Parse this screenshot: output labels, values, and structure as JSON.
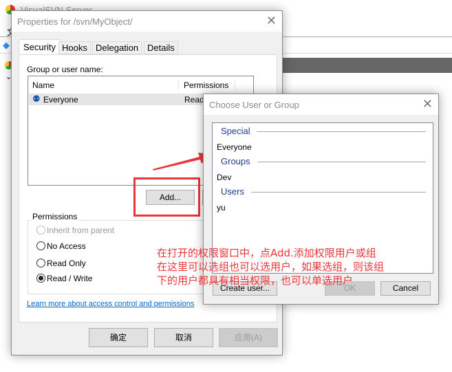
{
  "background_window": {
    "title": "VisualSVN Server",
    "menu_char": "文"
  },
  "properties": {
    "title": "Properties for /svn/MyObject/",
    "tabs": [
      "Security",
      "Hooks",
      "Delegation",
      "Details"
    ],
    "active_tab": "Security",
    "group_label": "Group or user name:",
    "columns": [
      "Name",
      "Permissions"
    ],
    "rows": [
      {
        "name": "Everyone",
        "permission": "Read"
      }
    ],
    "add_label": "Add...",
    "permissions_label": "Permissions",
    "radios": [
      {
        "label": "Inherit from parent",
        "disabled": true,
        "checked": false
      },
      {
        "label": "No Access",
        "disabled": false,
        "checked": false
      },
      {
        "label": "Read Only",
        "disabled": false,
        "checked": false
      },
      {
        "label": "Read / Write",
        "disabled": false,
        "checked": true
      }
    ],
    "link": "Learn more about access control and permissions",
    "ok_label": "确定",
    "cancel_label": "取消",
    "apply_label": "应用(A)"
  },
  "chooser": {
    "title": "Choose User or Group",
    "sections": [
      {
        "header": "Special",
        "items": [
          "Everyone"
        ]
      },
      {
        "header": "Groups",
        "items": [
          "Dev"
        ]
      },
      {
        "header": "Users",
        "items": [
          "yu"
        ]
      }
    ],
    "create_label": "Create user...",
    "ok_label": "OK",
    "cancel_label": "Cancel"
  },
  "annotation": {
    "lines": [
      "在打开的权限窗口中，点Add.添加权限用户或组",
      "在这里可以选组也可以选用户，如果选组，则该组",
      "下的用户都具有相当权限，也可以单选用户"
    ],
    "color": "#e8363a"
  }
}
